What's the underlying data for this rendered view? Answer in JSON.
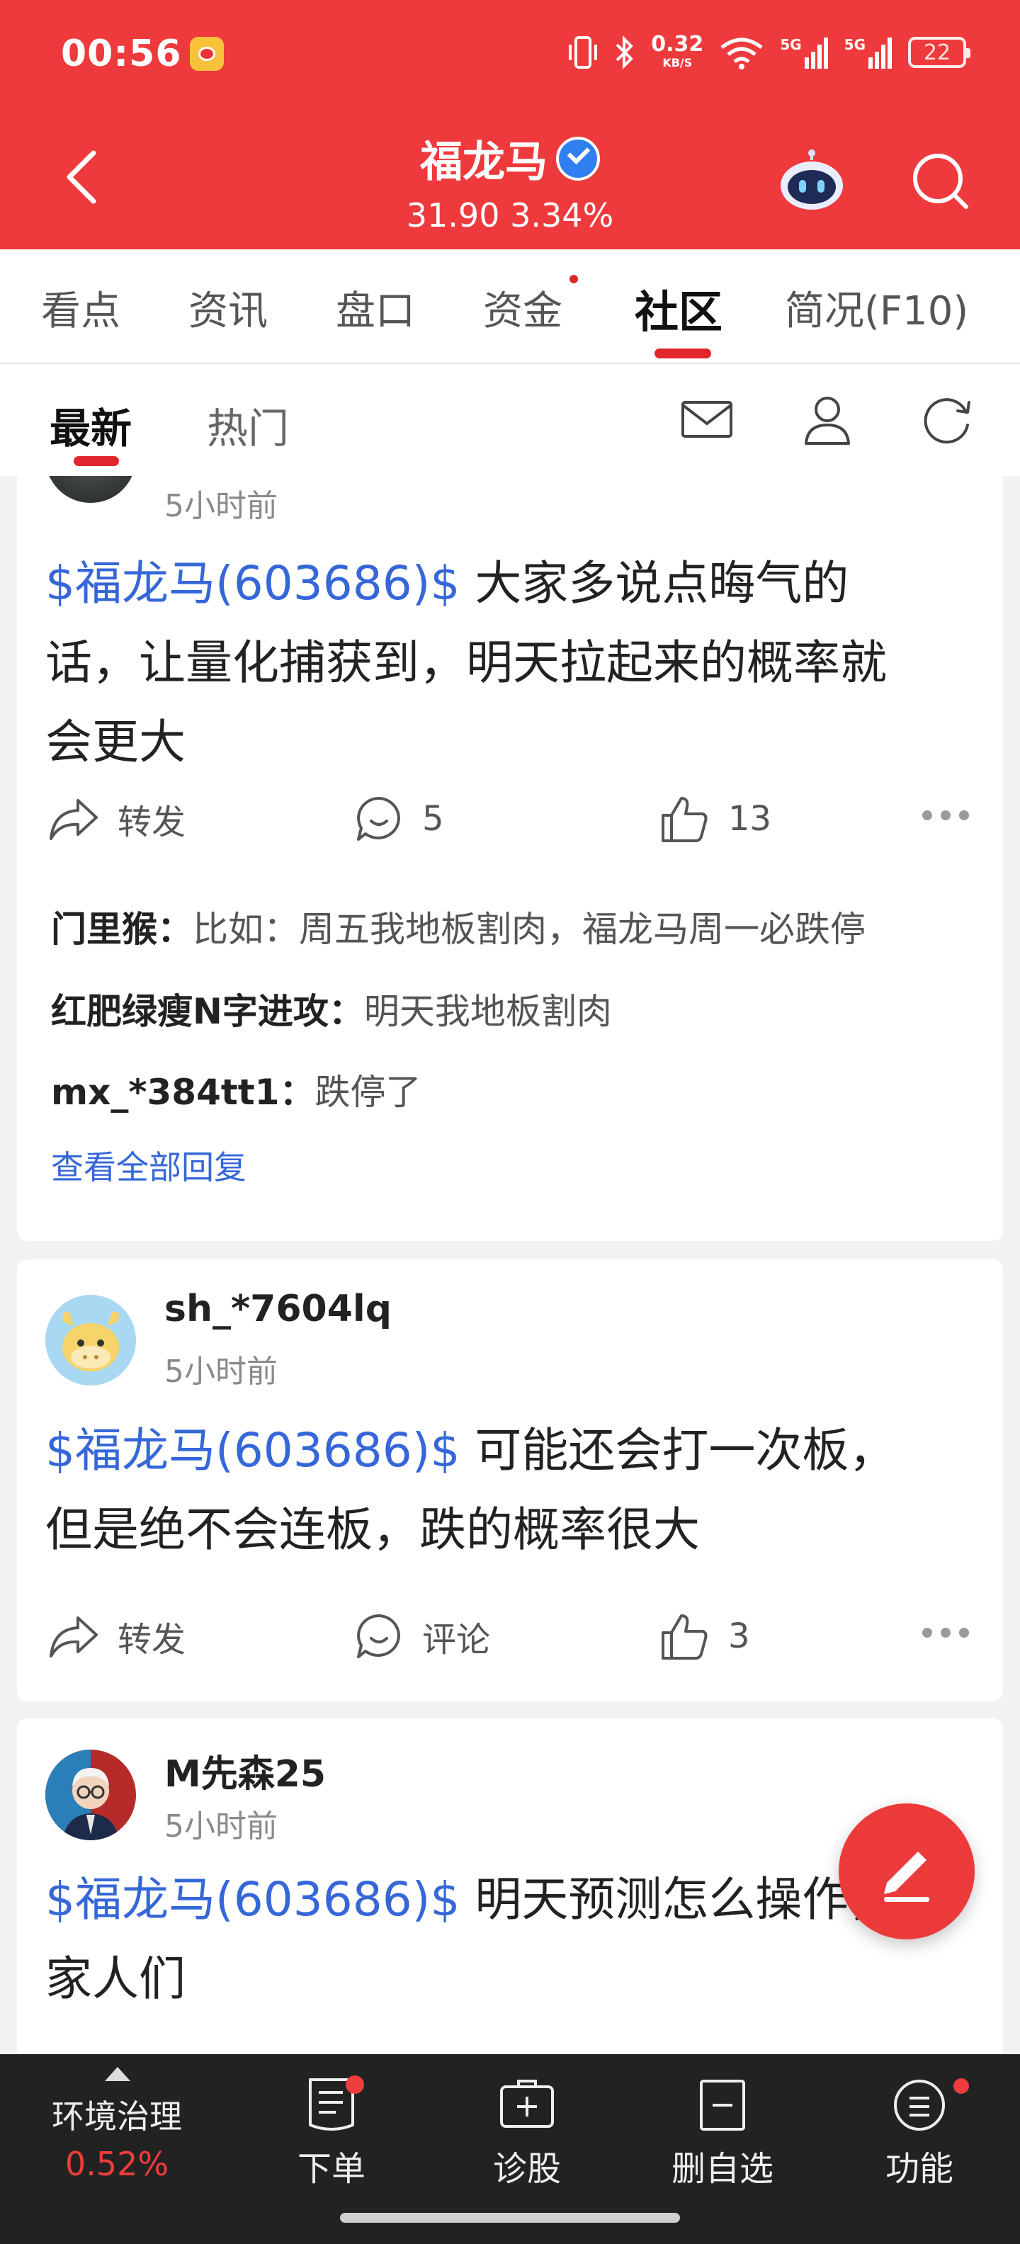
{
  "status_bar": {
    "time": "00:56",
    "net_speed_value": "0.32",
    "net_speed_unit": "KB/S",
    "signal_1": "5G",
    "signal_2": "5G",
    "battery": "22"
  },
  "header": {
    "stock_name": "福龙马",
    "price_change": "31.90 3.34%"
  },
  "tabs": [
    {
      "label": "看点"
    },
    {
      "label": "资讯"
    },
    {
      "label": "盘口"
    },
    {
      "label": "资金"
    },
    {
      "label": "社区"
    },
    {
      "label": "简况(F10)"
    }
  ],
  "subtabs": [
    {
      "label": "最新"
    },
    {
      "label": "热门"
    }
  ],
  "posts": [
    {
      "time": "5小时前",
      "stock_tag": "$福龙马(603686)$",
      "lines": [
        " 大家多说点晦气的",
        "话，让量化捕获到，明天拉起来的概率就",
        "会更大"
      ],
      "forward": "转发",
      "comment": "5",
      "like": "13",
      "replies": [
        {
          "user": "门里猴：",
          "text": "比如：周五我地板割肉，福龙马周一必跌停"
        },
        {
          "user": "红肥绿瘦N字进攻：",
          "text": "明天我地板割肉"
        },
        {
          "user": "mx_*384tt1：",
          "text": "跌停了"
        }
      ],
      "view_all": "查看全部回复"
    },
    {
      "user": "sh_*7604lq",
      "time": "5小时前",
      "stock_tag": "$福龙马(603686)$",
      "lines": [
        " 可能还会打一次板，",
        "但是绝不会连板，跌的概率很大"
      ],
      "forward": "转发",
      "comment": "评论",
      "like": "3"
    },
    {
      "user": "M先森25",
      "time": "5小时前",
      "stock_tag": "$福龙马(603686)$",
      "lines": [
        " 明天预测怎么操作，",
        "家人们"
      ]
    }
  ],
  "bottom_bar": {
    "index_name": "环境治理",
    "index_change": "0.52%",
    "items": [
      {
        "label": "下单"
      },
      {
        "label": "诊股"
      },
      {
        "label": "删自选"
      },
      {
        "label": "功能"
      }
    ]
  },
  "colors": {
    "brand_red": "#ee3a3c",
    "link_blue": "#3567d9",
    "bottom_bar": "#222222"
  }
}
